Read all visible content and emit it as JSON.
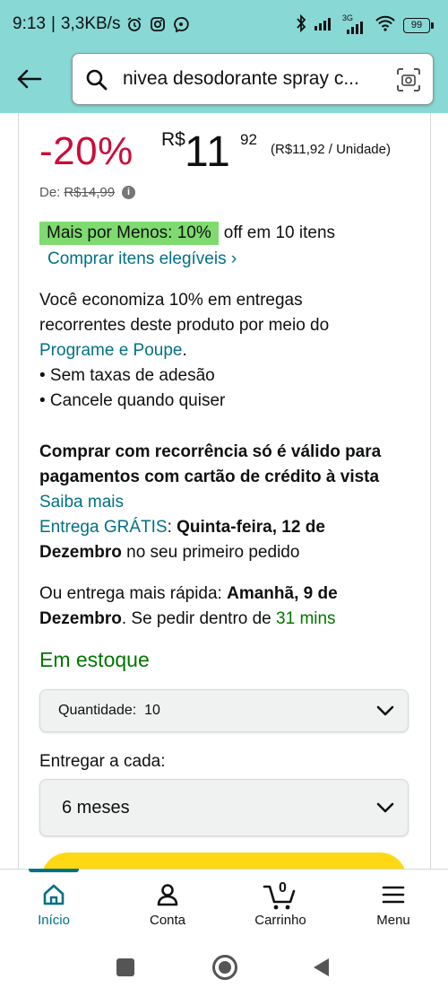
{
  "status": {
    "time": "9:13",
    "speed": "3,3KB/s",
    "network": "3G",
    "battery": "99"
  },
  "header": {
    "search_text": "nivea desodorante spray c..."
  },
  "price": {
    "discount": "-20%",
    "currency": "R$",
    "whole": "11",
    "cents": "92",
    "unit_price": "(R$11,92 / Unidade)",
    "list_label": "De:",
    "list_value": "R$14,99"
  },
  "promo": {
    "badge": "Mais por Menos: 10%",
    "after": "off em 10 itens",
    "link": "Comprar itens elegíveis ›"
  },
  "savings": {
    "line1": "Você economiza 10% em entregas",
    "line2": "recorrentes deste produto por meio do",
    "link": "Programe e Poupe",
    "period": ".",
    "bullet1": "• Sem taxas de adesão",
    "bullet2": "• Cancele quando quiser"
  },
  "recurrence": {
    "line1": "Comprar com recorrência só é válido para",
    "line2": "pagamentos com cartão de crédito à vista",
    "learn_more": "Saiba mais"
  },
  "delivery": {
    "free_label": "Entrega GRÁTIS",
    "colon": ":",
    "free_date_1": "Quinta-feira, 12 de",
    "free_date_2": "Dezembro",
    "free_suffix": "no seu primeiro pedido",
    "fast_prefix": "Ou entrega mais rápida:",
    "fast_date_1": "Amanhã, 9 de",
    "fast_date_2": "Dezembro",
    "fast_mid": ". Se pedir dentro de",
    "fast_time": "31 mins"
  },
  "stock": "Em estoque",
  "quantity": {
    "label": "Quantidade:",
    "value": "10"
  },
  "frequency": {
    "label": "Entregar a cada:",
    "value": "6 meses"
  },
  "bottom_nav": [
    {
      "label": "Início",
      "icon": "home-icon"
    },
    {
      "label": "Conta",
      "icon": "account-icon"
    },
    {
      "label": "Carrinho",
      "icon": "cart-icon",
      "badge": "0"
    },
    {
      "label": "Menu",
      "icon": "menu-icon"
    }
  ],
  "colors": {
    "header_bg": "#88d8d6",
    "discount_red": "#cc0c39",
    "link_teal": "#007185",
    "stock_green": "#007600",
    "promo_green": "#7fda6f",
    "cta_yellow": "#ffd814"
  }
}
